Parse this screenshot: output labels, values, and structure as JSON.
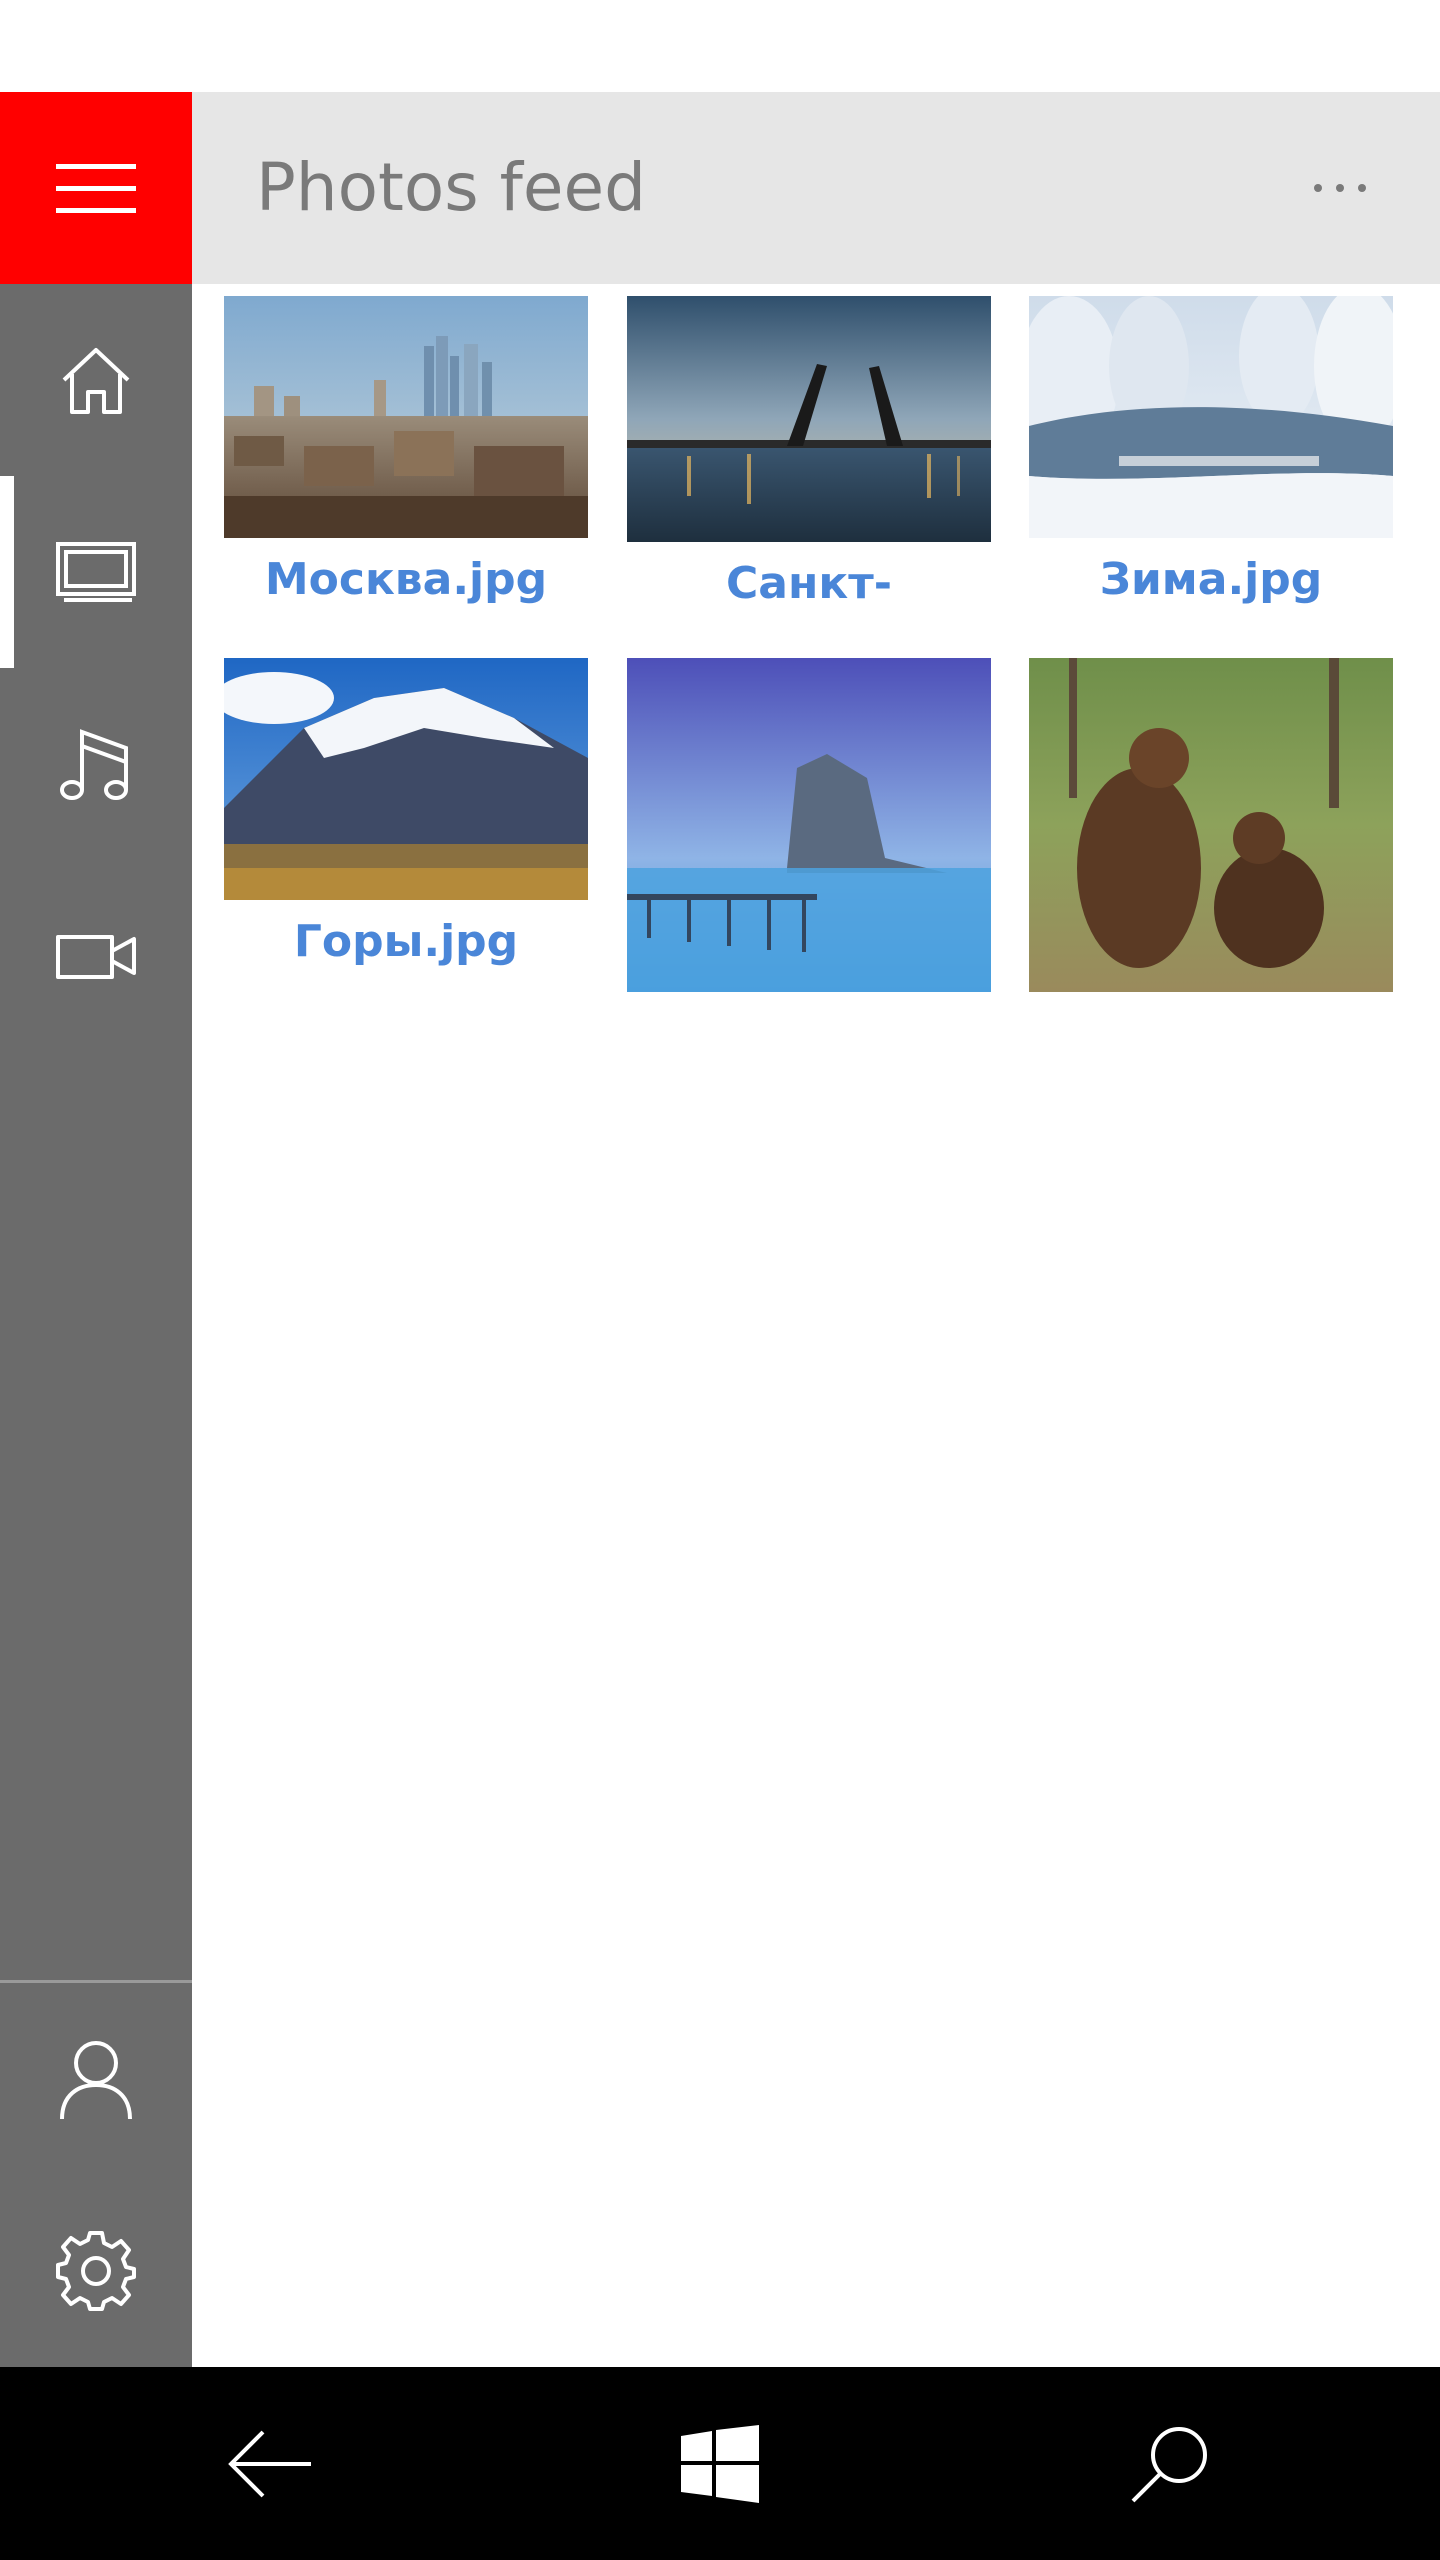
{
  "header": {
    "title": "Photos feed"
  },
  "sidebar": {
    "menu_icon": "hamburger-icon",
    "items": [
      {
        "icon": "home-icon",
        "selected": false
      },
      {
        "icon": "photos-icon",
        "selected": true
      },
      {
        "icon": "music-icon",
        "selected": false
      },
      {
        "icon": "video-icon",
        "selected": false
      }
    ],
    "bottom_items": [
      {
        "icon": "user-icon"
      },
      {
        "icon": "settings-icon"
      }
    ]
  },
  "photos": [
    {
      "caption": "Москва.jpg",
      "subject": "city skyline"
    },
    {
      "caption": "Санкт-",
      "subject": "drawbridge at dusk"
    },
    {
      "caption": "Зима.jpg",
      "subject": "snowy forest river"
    },
    {
      "caption": "Горы.jpg",
      "subject": "snow-capped mountain"
    },
    {
      "caption": "",
      "subject": "rock in misty sea with pier"
    },
    {
      "caption": "",
      "subject": "two brown bears"
    }
  ],
  "navbar": {
    "back_icon": "back-arrow-icon",
    "start_icon": "windows-logo-icon",
    "search_icon": "search-icon"
  },
  "colors": {
    "accent": "#ff0000",
    "sidebar": "#6b6b6b",
    "header": "#e6e6e6",
    "caption": "#4a86d8",
    "navbar": "#000000"
  }
}
